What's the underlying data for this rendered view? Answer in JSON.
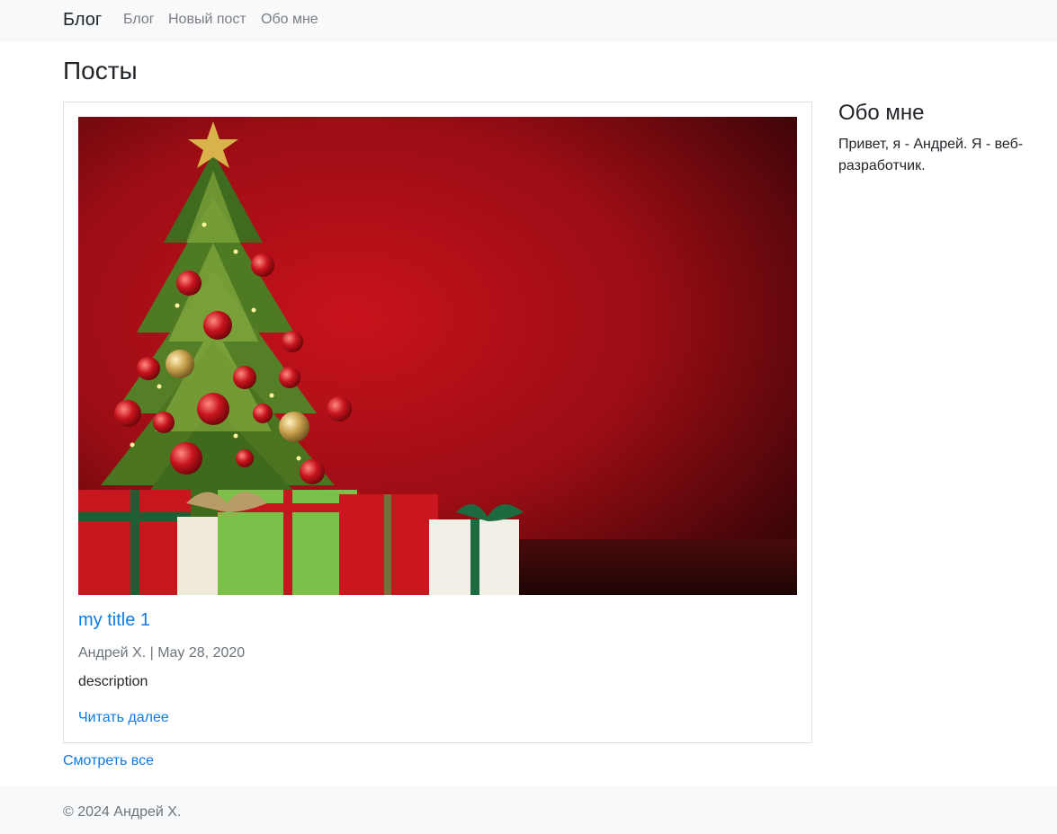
{
  "navbar": {
    "brand": "Блог",
    "links": [
      "Блог",
      "Новый пост",
      "Обо мне"
    ]
  },
  "main": {
    "title": "Посты",
    "posts": [
      {
        "title": "my title 1",
        "author": "Андрей Х.",
        "separator": "|",
        "date": "May 28, 2020",
        "description": "description",
        "read_more": "Читать далее",
        "image": "christmas-tree-with-gifts"
      }
    ],
    "view_all": "Смотреть все"
  },
  "sidebar": {
    "title": "Обо мне",
    "text": "Привет, я - Андрей. Я - веб-разработчик."
  },
  "footer": {
    "text": "© 2024 Андрей Х."
  },
  "colors": {
    "link": "#0d7ae6",
    "navbar_bg": "#f8f9fa",
    "muted": "#6c757d"
  }
}
